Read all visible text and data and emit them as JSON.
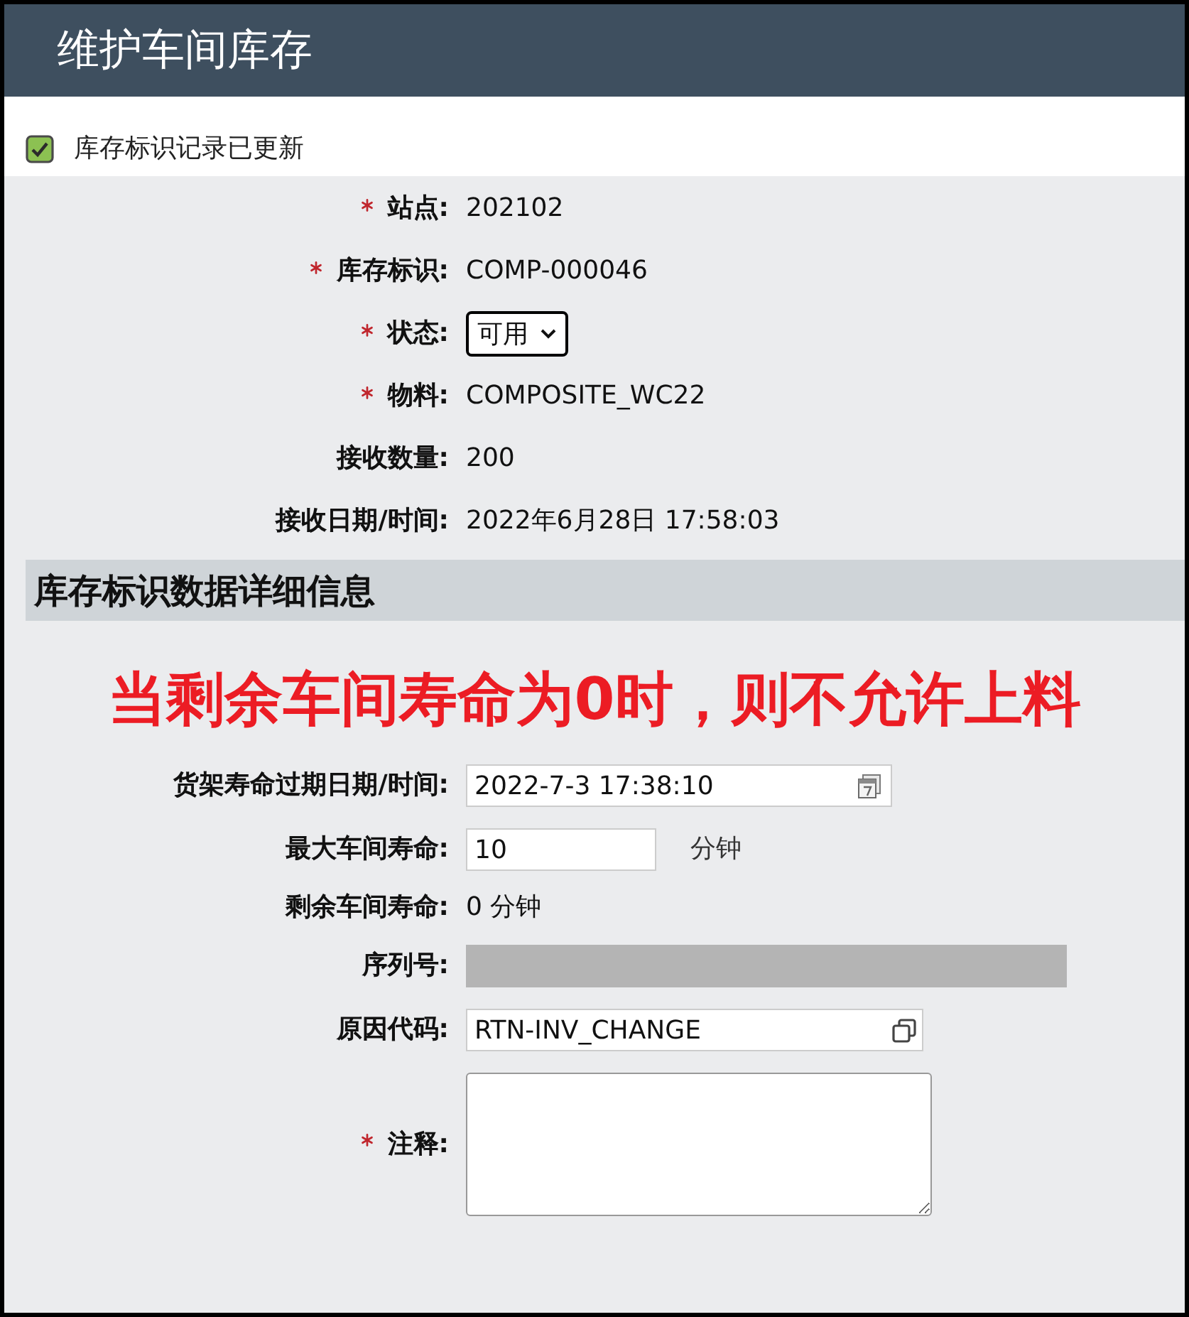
{
  "header": {
    "title": "维护车间库存"
  },
  "message": {
    "checked": true,
    "text": "库存标识记录已更新"
  },
  "fields": [
    {
      "kind": "text",
      "label": "站点:",
      "required": true,
      "value": "202102"
    },
    {
      "kind": "text",
      "label": "库存标识:",
      "required": true,
      "value": "COMP-000046"
    },
    {
      "kind": "select",
      "label": "状态:",
      "required": true,
      "value": "可用"
    },
    {
      "kind": "text",
      "label": "物料:",
      "required": true,
      "value": "COMPOSITE_WC22"
    },
    {
      "kind": "text",
      "label": "接收数量:",
      "required": false,
      "value": "200"
    },
    {
      "kind": "text",
      "label": "接收日期/时间:",
      "required": false,
      "value": "2022年6月28日 17:58:03"
    }
  ],
  "section": {
    "title": "库存标识数据详细信息",
    "notice": "当剩余车间寿命为0时，则不允许上料",
    "fields": [
      {
        "kind": "date",
        "label": "货架寿命过期日期/时间:",
        "required": false,
        "value": "2022-7-3 17:38:10"
      },
      {
        "kind": "input",
        "label": "最大车间寿命:",
        "required": false,
        "value": "10",
        "unit": "分钟",
        "disabled": false
      },
      {
        "kind": "text",
        "label": "剩余车间寿命:",
        "required": false,
        "value": "0 分钟"
      },
      {
        "kind": "input",
        "label": "序列号:",
        "required": false,
        "disabled": true
      },
      {
        "kind": "lookup",
        "label": "原因代码:",
        "required": false,
        "value": "RTN-INV_CHANGE"
      },
      {
        "kind": "textarea",
        "label": "注释:",
        "required": true
      }
    ]
  }
}
